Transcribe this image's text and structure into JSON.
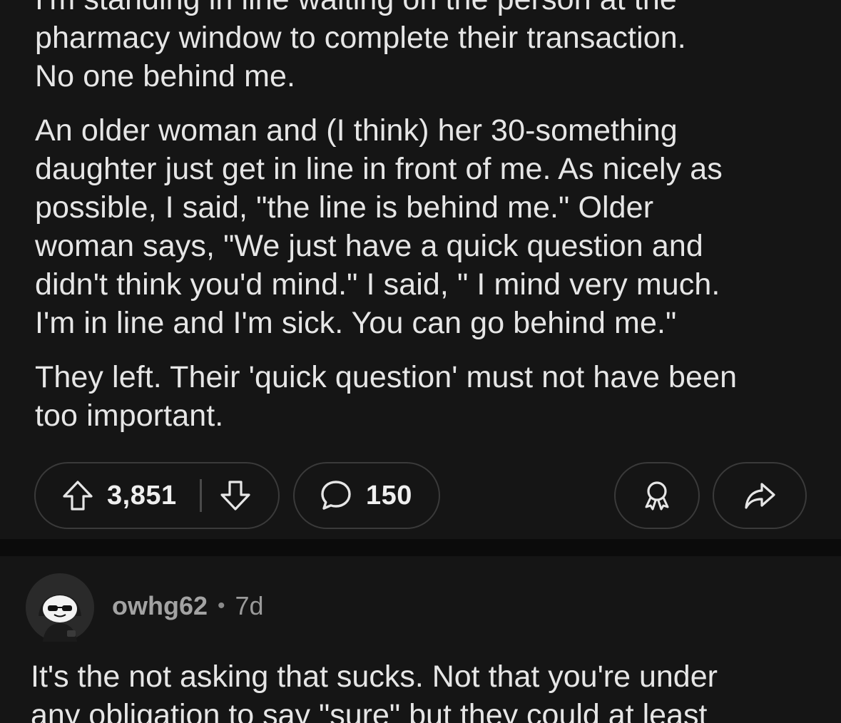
{
  "post": {
    "paragraphs": [
      {
        "lines": [
          "I'm standing in line waiting on the person at the",
          "pharmacy window to complete their transaction.",
          "No one behind me."
        ]
      },
      {
        "lines": [
          "An older woman and (I think) her 30-something",
          "daughter just get in line in front of me.  As nicely as",
          "possible, I said, \"the line is behind me.\"  Older",
          "woman says, \"We just have a quick question and",
          "didn't think you'd mind.\"  I said, \" I mind very much.",
          "I'm in line and I'm sick.  You can go behind me.\""
        ]
      },
      {
        "lines": [
          "They left.  Their 'quick question' must not have been",
          "too important."
        ]
      }
    ],
    "votes": "3,851",
    "comments": "150"
  },
  "icons": {
    "upvote": "arrow-up-icon",
    "downvote": "arrow-down-icon",
    "comment": "speech-bubble-icon",
    "award": "award-ribbon-icon",
    "share": "share-arrow-icon",
    "avatar": "snoo-avatar-icon"
  },
  "comment": {
    "username": "owhg62",
    "separator": "•",
    "age": "7d",
    "lines": [
      "It's the not asking that sucks. Not that you're under",
      "any obligation to say \"sure\" but they could at least"
    ]
  },
  "colors": {
    "background": "#0b0b0b",
    "card": "#151515",
    "text": "#e6e6e6",
    "muted": "#9a9a9a",
    "border": "#3a3a3a"
  }
}
